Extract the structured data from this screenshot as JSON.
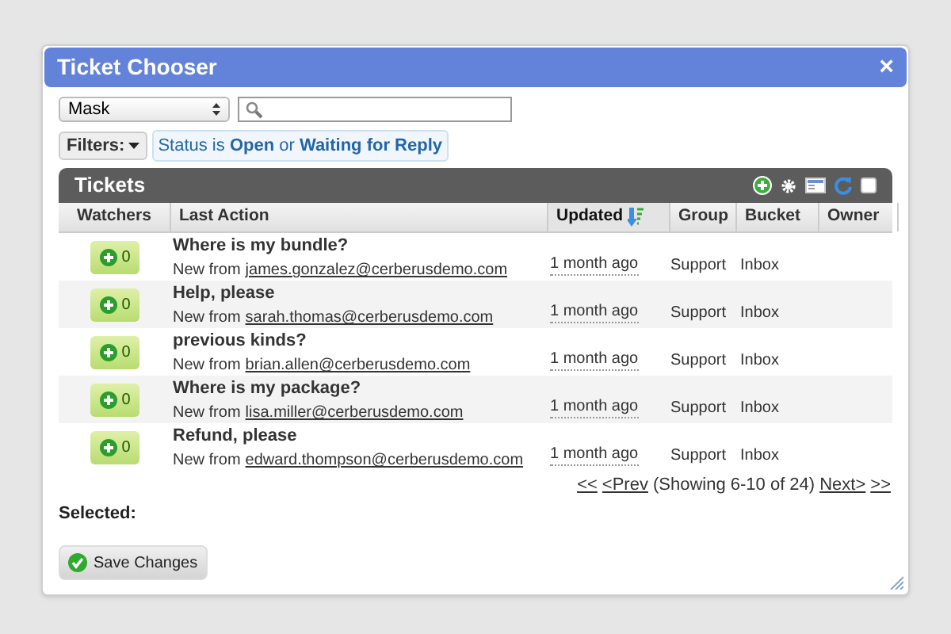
{
  "window": {
    "title": "Ticket Chooser",
    "close": "×"
  },
  "mask_select": {
    "value": "Mask"
  },
  "filters": {
    "label": "Filters:",
    "criteria": "Status is **Open** or **Waiting for Reply**"
  },
  "worklist": {
    "title": "Tickets",
    "header_select_all": {
      "checked": false
    },
    "columns": [
      {
        "label": "Watchers",
        "sorted": false
      },
      {
        "label": "Last Action",
        "sorted": false
      },
      {
        "label": "Updated",
        "sorted": true
      },
      {
        "label": "Group",
        "sorted": false
      },
      {
        "label": "Bucket",
        "sorted": false
      },
      {
        "label": "Owner",
        "sorted": false
      }
    ],
    "rows": [
      {
        "watchers": "0",
        "subject": "Where is my bundle?",
        "action": "New from",
        "email": "james.gonzalez@cerberusdemo.com",
        "updated": "1 month ago",
        "group": "Support",
        "bucket": "Inbox"
      },
      {
        "watchers": "0",
        "subject": "Help, please",
        "action": "New from",
        "email": "sarah.thomas@cerberusdemo.com",
        "updated": "1 month ago",
        "group": "Support",
        "bucket": "Inbox"
      },
      {
        "watchers": "0",
        "subject": "previous kinds?",
        "action": "New from",
        "email": "brian.allen@cerberusdemo.com",
        "updated": "1 month ago",
        "group": "Support",
        "bucket": "Inbox"
      },
      {
        "watchers": "0",
        "subject": "Where is my package?",
        "action": "New from",
        "email": "lisa.miller@cerberusdemo.com",
        "updated": "1 month ago",
        "group": "Support",
        "bucket": "Inbox"
      },
      {
        "watchers": "0",
        "subject": "Refund, please",
        "action": "New from",
        "email": "edward.thompson@cerberusdemo.com",
        "updated": "1 month ago",
        "group": "Support",
        "bucket": "Inbox"
      }
    ]
  },
  "pagination": {
    "first": "<<",
    "prev": "<Prev",
    "status": "(Showing 6-10 of 24)",
    "next": "Next>",
    "last": ">>"
  },
  "selected_label": "Selected:",
  "save_button": "Save Changes"
}
